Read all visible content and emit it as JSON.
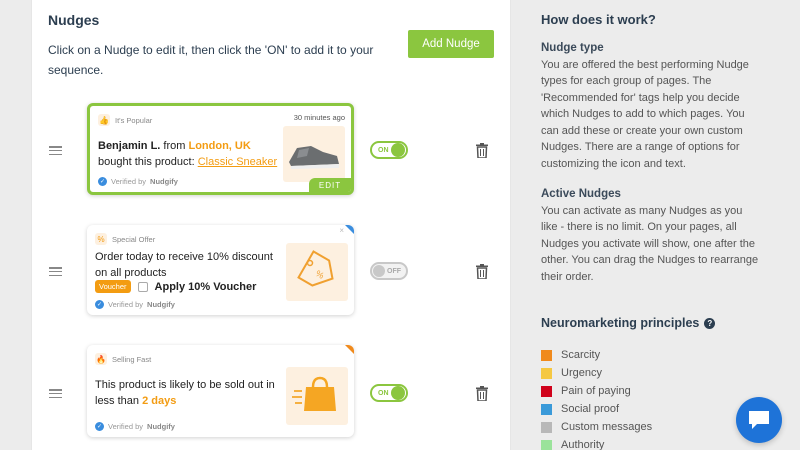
{
  "main": {
    "title": "Nudges",
    "intro": "Click on a Nudge to edit it, then click the 'ON' to add it to your sequence.",
    "add_button": "Add Nudge"
  },
  "nudges": [
    {
      "tag": "It's Popular",
      "time": "30 minutes ago",
      "name": "Benjamin L.",
      "from": "from",
      "location": "London, UK",
      "bought": "bought",
      "product_prefix": "this product:",
      "product": "Classic Sneaker",
      "verified_prefix": "Verified by",
      "verified_brand": "Nudgify",
      "edit_label": "EDIT",
      "toggle": "ON",
      "icon": "thumbs-up-icon"
    },
    {
      "tag": "Special Offer",
      "message": "Order today to receive 10% discount on all products",
      "voucher_badge": "Voucher",
      "voucher_label": "Apply 10% Voucher",
      "close": "×",
      "verified_prefix": "Verified by",
      "verified_brand": "Nudgify",
      "toggle": "OFF",
      "icon": "percent-tag-icon"
    },
    {
      "tag": "Selling Fast",
      "message_prefix": "This product is likely to be sold out in less than",
      "message_highlight": "2 days",
      "verified_prefix": "Verified by",
      "verified_brand": "Nudgify",
      "toggle": "ON",
      "icon": "shopping-bag-icon"
    }
  ],
  "sidebar": {
    "title": "How does it work?",
    "nudge_type_title": "Nudge type",
    "nudge_type_text": "You are offered the best performing Nudge types for each group of pages. The 'Recommended for' tags help you decide which Nudges to add to which pages. You can add these or create your own custom Nudges. There are a range of options for customizing the icon and text.",
    "active_title": "Active Nudges",
    "active_text": "You can activate as many Nudges as you like - there is no limit. On your pages, all Nudges you activate will show, one after the other. You can drag the Nudges to rearrange their order.",
    "principles_title": "Neuromarketing principles",
    "principles": [
      {
        "label": "Scarcity",
        "color": "#f08a1c"
      },
      {
        "label": "Urgency",
        "color": "#f5c842"
      },
      {
        "label": "Pain of paying",
        "color": "#d0021b"
      },
      {
        "label": "Social proof",
        "color": "#3a9ad9"
      },
      {
        "label": "Custom messages",
        "color": "#b8b8b8"
      },
      {
        "label": "Authority",
        "color": "#9be39b"
      }
    ]
  },
  "colors": {
    "accent": "#8bc63f",
    "orange": "#f39c12",
    "chat": "#1e73d8"
  }
}
